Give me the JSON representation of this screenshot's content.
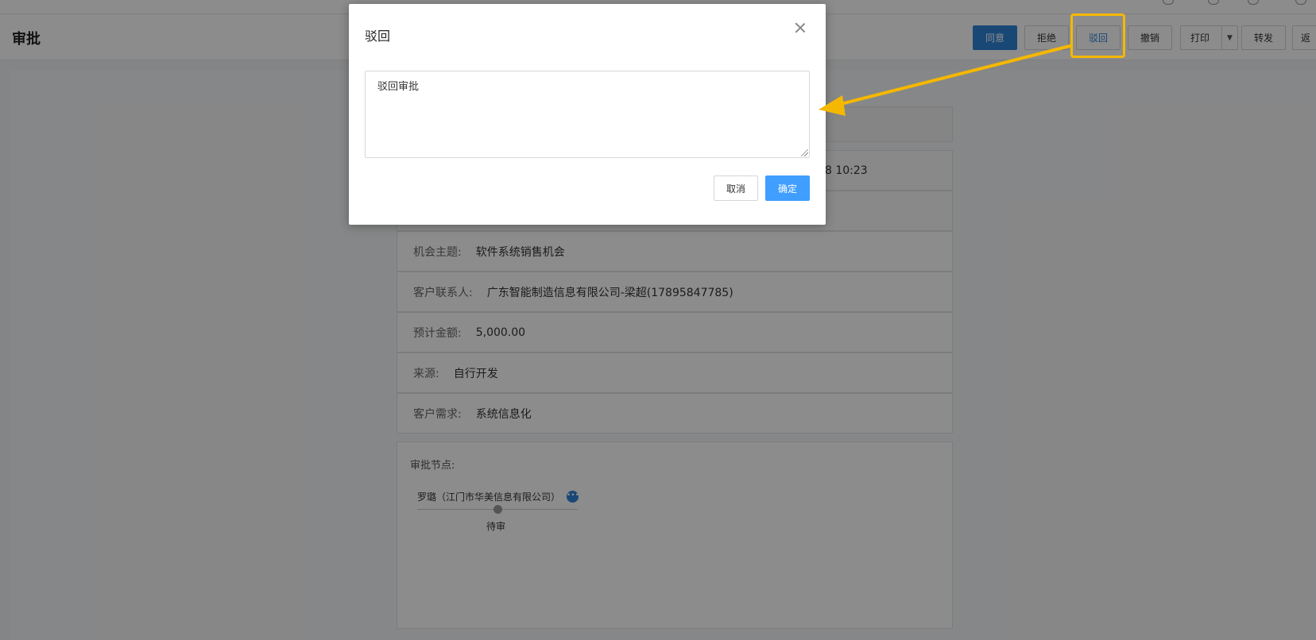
{
  "header": {
    "title": "审批",
    "buttons": {
      "agree": "同意",
      "reject": "拒绝",
      "return": "驳回",
      "revoke": "撤销",
      "print": "打印",
      "forward": "转发",
      "back": "返"
    }
  },
  "detail": {
    "partial_time": "8 10:23",
    "rows": [
      {
        "label": "机会主题:",
        "value": "软件系统销售机会"
      },
      {
        "label": "客户联系人:",
        "value": "广东智能制造信息有限公司-梁超(17895847785)"
      },
      {
        "label": "预计金额:",
        "value": "5,000.00"
      },
      {
        "label": "来源:",
        "value": "自行开发"
      },
      {
        "label": "客户需求:",
        "value": "系统信息化"
      }
    ]
  },
  "approval_nodes": {
    "title": "审批节点:",
    "person": "罗璐（江门市华美信息有限公司）",
    "more_icon": "ellipsis-icon",
    "status": "待审"
  },
  "modal": {
    "title": "驳回",
    "textarea_value": "驳回审批",
    "cancel_label": "取消",
    "ok_label": "确定"
  },
  "annotation": {
    "color": "#f5b800"
  }
}
